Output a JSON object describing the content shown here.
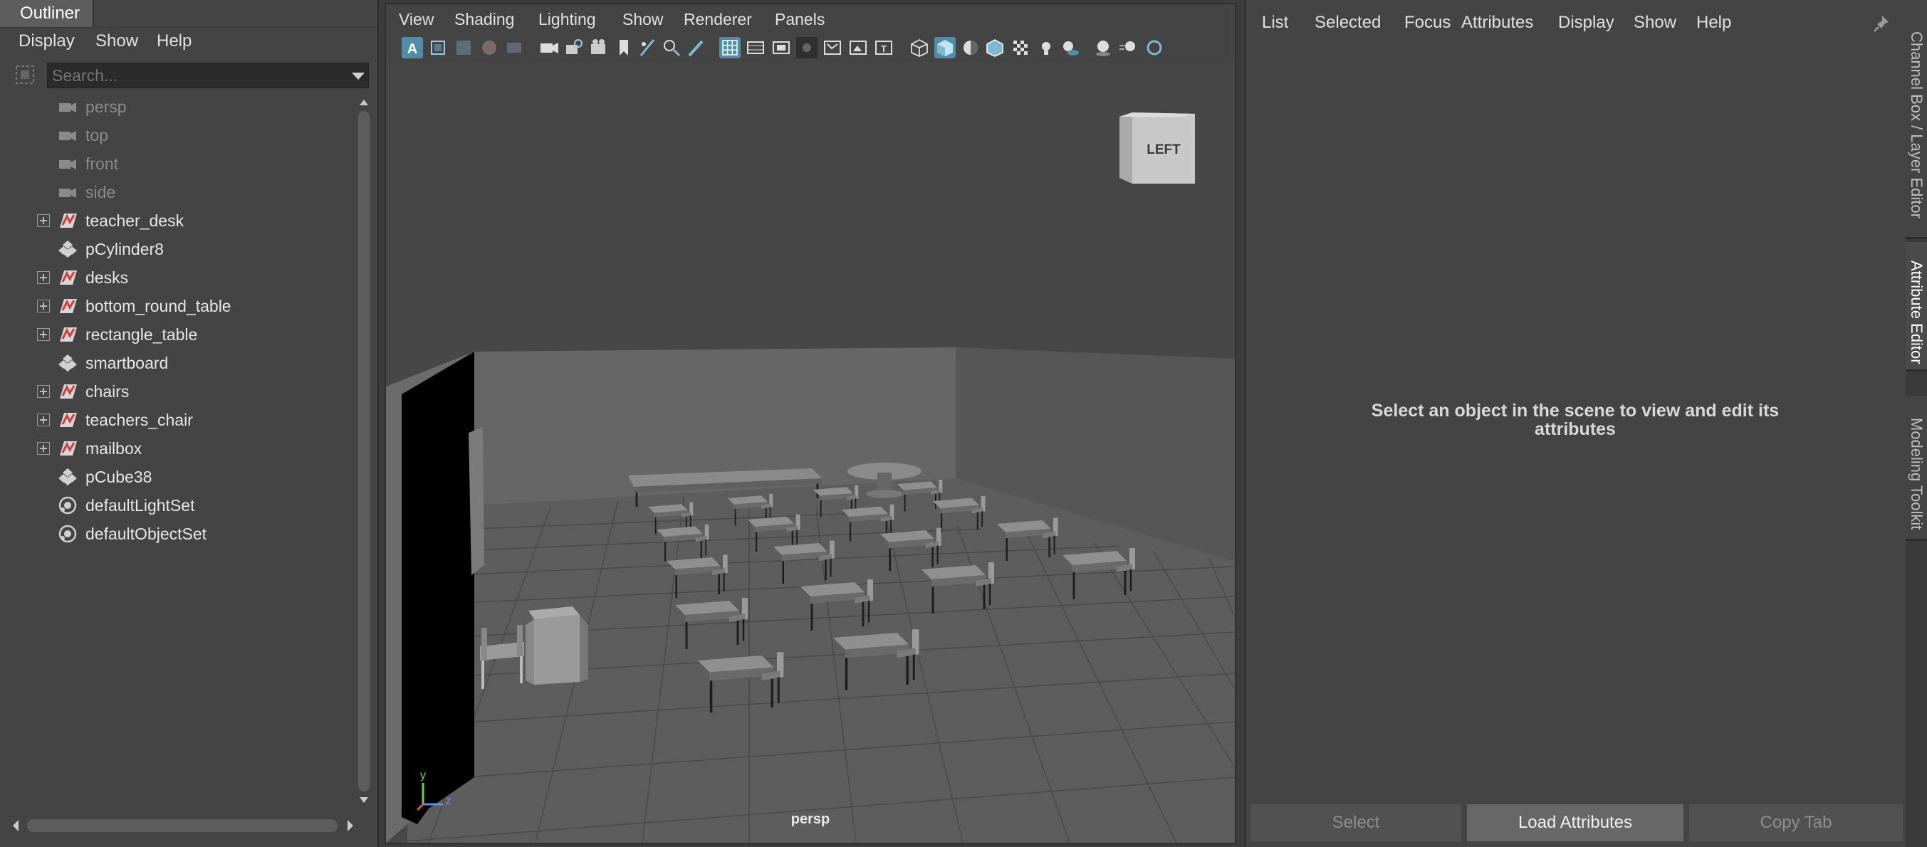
{
  "outliner": {
    "tab_label": "Outliner",
    "menu": [
      "Display",
      "Show",
      "Help"
    ],
    "search_placeholder": "Search...",
    "items": [
      {
        "label": "persp",
        "icon": "camera-icon",
        "expandable": false,
        "dim": true
      },
      {
        "label": "top",
        "icon": "camera-icon",
        "expandable": false,
        "dim": true
      },
      {
        "label": "front",
        "icon": "camera-icon",
        "expandable": false,
        "dim": true
      },
      {
        "label": "side",
        "icon": "camera-icon",
        "expandable": false,
        "dim": true
      },
      {
        "label": "teacher_desk",
        "icon": "group-transform-icon",
        "expandable": true,
        "dim": false
      },
      {
        "label": "pCylinder8",
        "icon": "mesh-icon",
        "expandable": false,
        "dim": false
      },
      {
        "label": "desks",
        "icon": "group-transform-icon",
        "expandable": true,
        "dim": false
      },
      {
        "label": "bottom_round_table",
        "icon": "group-transform-icon",
        "expandable": true,
        "dim": false
      },
      {
        "label": "rectangle_table",
        "icon": "group-transform-icon",
        "expandable": true,
        "dim": false
      },
      {
        "label": "smartboard",
        "icon": "mesh-icon",
        "expandable": false,
        "dim": false
      },
      {
        "label": "chairs",
        "icon": "group-transform-icon",
        "expandable": true,
        "dim": false
      },
      {
        "label": "teachers_chair",
        "icon": "group-transform-icon",
        "expandable": true,
        "dim": false
      },
      {
        "label": "mailbox",
        "icon": "group-transform-icon",
        "expandable": true,
        "dim": false
      },
      {
        "label": "pCube38",
        "icon": "mesh-icon",
        "expandable": false,
        "dim": false
      },
      {
        "label": "defaultLightSet",
        "icon": "set-icon",
        "expandable": false,
        "dim": false
      },
      {
        "label": "defaultObjectSet",
        "icon": "set-icon",
        "expandable": false,
        "dim": false
      }
    ]
  },
  "viewport": {
    "menu": [
      "View",
      "Shading",
      "Lighting",
      "Show",
      "Renderer",
      "Panels"
    ],
    "toolbar_icons": [
      "select-camera-icon",
      "camera-attributes-icon",
      "bookmark-icon",
      "image-plane-icon",
      "grid-icon",
      "film-gate-icon",
      "resolution-gate-icon",
      "gate-mask-icon",
      "field-chart-icon",
      "safe-action-icon",
      "safe-title-icon",
      "wireframe-icon",
      "smooth-shade-icon",
      "textured-icon",
      "wireframe-on-shaded-icon",
      "xray-icon",
      "lights-icon",
      "shadows-icon",
      "ambient-occlusion-icon",
      "motion-blur-icon"
    ],
    "view_cube_label": "LEFT",
    "camera_label": "persp",
    "axis_labels": {
      "y": "y",
      "z": "z"
    }
  },
  "attribute_editor": {
    "menu": [
      "List",
      "Selected",
      "Focus",
      "Attributes",
      "Display",
      "Show",
      "Help"
    ],
    "message": "Select an object in the scene to view and edit its attributes",
    "buttons": [
      {
        "label": "Select",
        "active": false
      },
      {
        "label": "Load Attributes",
        "active": true
      },
      {
        "label": "Copy Tab",
        "active": false
      }
    ]
  },
  "side_tabs": [
    {
      "label": "Channel Box / Layer Editor",
      "active": false
    },
    {
      "label": "Attribute Editor",
      "active": true
    },
    {
      "label": "Modeling Toolkit",
      "active": false
    }
  ],
  "colors": {
    "accent": "#4f8ea6",
    "panel": "#444444",
    "selection_red": "#d43b3b"
  }
}
